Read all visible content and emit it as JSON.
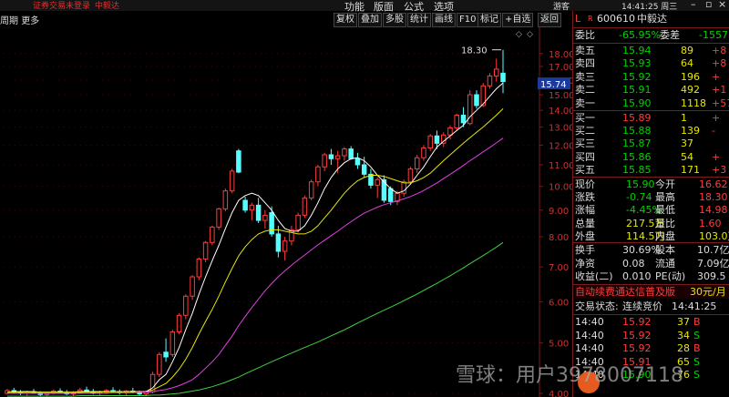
{
  "topbar": {
    "status_text": "证券交易未登录",
    "stock_name": "中毅达",
    "menus": [
      "功能",
      "版面",
      "公式",
      "选项"
    ],
    "extra_menu": "游客",
    "clock": "14:41:25 周三"
  },
  "toolbar": {
    "period": "周期",
    "more": "更多",
    "buttons": [
      "复权",
      "叠加",
      "多股",
      "统计",
      "画线",
      "F10",
      "标记",
      "+自选",
      "返回"
    ]
  },
  "chart_data": {
    "type": "candlestick",
    "title": "",
    "y_ticks": [
      4.0,
      5.0,
      6.0,
      7.0,
      8.0,
      9.0,
      10.0,
      11.0,
      12.0,
      13.0,
      14.0,
      15.0,
      16.0,
      17.0,
      18.0
    ],
    "ylim": [
      4.0,
      18.5
    ],
    "current_price_label": "15.74",
    "high_annotation": "18.30",
    "candles": [
      [
        4.0,
        4.08,
        3.98,
        4.05
      ],
      [
        4.05,
        4.1,
        4.0,
        4.02
      ],
      [
        4.02,
        4.06,
        3.97,
        4.0
      ],
      [
        4.0,
        4.05,
        3.96,
        4.03
      ],
      [
        4.03,
        4.08,
        3.99,
        4.01
      ],
      [
        4.01,
        4.04,
        3.95,
        3.98
      ],
      [
        3.98,
        4.03,
        3.94,
        4.0
      ],
      [
        4.0,
        4.07,
        3.98,
        4.04
      ],
      [
        4.04,
        4.09,
        4.0,
        4.02
      ],
      [
        4.02,
        4.06,
        3.97,
        3.99
      ],
      [
        3.99,
        4.04,
        3.95,
        4.01
      ],
      [
        4.01,
        4.1,
        3.99,
        4.06
      ],
      [
        4.06,
        4.12,
        4.02,
        4.03
      ],
      [
        4.03,
        4.08,
        3.98,
        4.0
      ],
      [
        4.0,
        4.05,
        3.96,
        4.02
      ],
      [
        4.02,
        4.08,
        3.99,
        4.05
      ],
      [
        4.05,
        4.11,
        4.01,
        4.03
      ],
      [
        4.03,
        4.07,
        3.98,
        4.01
      ],
      [
        4.01,
        4.06,
        3.97,
        4.04
      ],
      [
        4.04,
        4.1,
        4.0,
        4.02
      ],
      [
        4.02,
        4.05,
        3.96,
        3.99
      ],
      [
        3.99,
        4.05,
        3.95,
        4.03
      ],
      [
        4.03,
        4.4,
        4.0,
        4.35
      ],
      [
        4.35,
        4.8,
        4.3,
        4.75
      ],
      [
        4.8,
        5.1,
        4.6,
        4.7
      ],
      [
        4.75,
        5.3,
        4.7,
        5.25
      ],
      [
        5.25,
        5.7,
        5.2,
        5.65
      ],
      [
        5.65,
        6.2,
        5.55,
        6.15
      ],
      [
        6.15,
        6.75,
        6.05,
        6.7
      ],
      [
        6.7,
        7.3,
        6.6,
        7.25
      ],
      [
        7.25,
        7.85,
        7.15,
        7.8
      ],
      [
        7.8,
        8.4,
        7.7,
        8.35
      ],
      [
        8.35,
        9.1,
        8.25,
        9.05
      ],
      [
        9.05,
        9.9,
        8.95,
        9.8
      ],
      [
        9.8,
        10.8,
        9.7,
        10.7
      ],
      [
        11.7,
        11.8,
        10.6,
        10.65
      ],
      [
        9.4,
        9.55,
        8.9,
        9.0
      ],
      [
        9.0,
        9.3,
        8.6,
        9.2
      ],
      [
        9.2,
        9.5,
        8.5,
        8.6
      ],
      [
        8.6,
        9.0,
        8.3,
        8.8
      ],
      [
        8.9,
        9.15,
        8.0,
        8.1
      ],
      [
        8.1,
        8.4,
        7.3,
        7.5
      ],
      [
        7.5,
        8.0,
        7.2,
        7.85
      ],
      [
        7.85,
        8.4,
        7.7,
        8.25
      ],
      [
        8.25,
        8.9,
        8.15,
        8.8
      ],
      [
        8.8,
        9.6,
        8.7,
        9.5
      ],
      [
        9.5,
        10.3,
        9.4,
        10.2
      ],
      [
        10.2,
        11.0,
        10.0,
        10.9
      ],
      [
        10.9,
        11.6,
        10.7,
        11.5
      ],
      [
        11.5,
        11.8,
        11.0,
        11.3
      ],
      [
        11.3,
        11.7,
        10.6,
        11.45
      ],
      [
        11.45,
        11.9,
        11.2,
        11.8
      ],
      [
        11.8,
        11.95,
        11.25,
        11.3
      ],
      [
        11.3,
        11.6,
        10.8,
        11.0
      ],
      [
        11.0,
        11.4,
        10.4,
        10.55
      ],
      [
        10.55,
        10.8,
        9.9,
        10.05
      ],
      [
        10.05,
        10.4,
        9.5,
        10.3
      ],
      [
        10.3,
        10.5,
        9.3,
        9.4
      ],
      [
        9.9,
        10.0,
        9.2,
        9.35
      ],
      [
        9.35,
        9.8,
        9.2,
        9.7
      ],
      [
        9.7,
        10.3,
        9.55,
        10.2
      ],
      [
        10.2,
        10.9,
        10.1,
        10.8
      ],
      [
        10.8,
        11.5,
        10.6,
        11.35
      ],
      [
        11.35,
        12.0,
        11.2,
        11.85
      ],
      [
        11.85,
        12.6,
        11.7,
        12.5
      ],
      [
        12.5,
        12.8,
        11.8,
        12.1
      ],
      [
        12.1,
        12.7,
        11.9,
        12.55
      ],
      [
        12.55,
        13.1,
        12.3,
        12.95
      ],
      [
        12.95,
        13.8,
        12.8,
        13.7
      ],
      [
        13.7,
        14.2,
        13.0,
        13.25
      ],
      [
        13.2,
        15.3,
        13.1,
        15.0
      ],
      [
        15.0,
        15.3,
        14.1,
        14.3
      ],
      [
        14.3,
        15.8,
        14.2,
        15.6
      ],
      [
        15.6,
        16.5,
        15.4,
        16.3
      ],
      [
        16.3,
        17.6,
        15.9,
        16.8
      ],
      [
        16.5,
        18.3,
        15.1,
        15.9
      ]
    ],
    "ma": [
      {
        "name": "MA5",
        "color": "#ffffff",
        "values": [
          4.02,
          4.03,
          4.03,
          4.03,
          4.03,
          4.02,
          4.02,
          4.02,
          4.02,
          4.02,
          4.02,
          4.03,
          4.03,
          4.03,
          4.03,
          4.03,
          4.03,
          4.03,
          4.03,
          4.03,
          4.03,
          4.03,
          4.1,
          4.25,
          4.35,
          4.6,
          4.9,
          5.3,
          5.7,
          6.2,
          6.7,
          7.2,
          7.7,
          8.3,
          8.9,
          9.4,
          9.6,
          9.7,
          9.6,
          9.3,
          9.0,
          8.6,
          8.3,
          8.2,
          8.2,
          8.4,
          8.8,
          9.3,
          9.9,
          10.4,
          10.8,
          11.1,
          11.3,
          11.35,
          11.2,
          10.9,
          10.5,
          10.2,
          9.9,
          9.7,
          9.8,
          10.1,
          10.5,
          10.9,
          11.4,
          11.9,
          12.2,
          12.5,
          12.8,
          13.1,
          13.6,
          14.0,
          14.4,
          14.9,
          15.4,
          15.8
        ]
      },
      {
        "name": "MA10",
        "color": "#e6e600",
        "values": [
          4.02,
          4.02,
          4.02,
          4.02,
          4.02,
          4.02,
          4.02,
          4.02,
          4.02,
          4.02,
          4.02,
          4.02,
          4.02,
          4.02,
          4.02,
          4.03,
          4.03,
          4.03,
          4.03,
          4.03,
          4.03,
          4.03,
          4.06,
          4.12,
          4.18,
          4.3,
          4.45,
          4.65,
          4.9,
          5.2,
          5.5,
          5.8,
          6.15,
          6.55,
          6.95,
          7.35,
          7.65,
          7.9,
          8.1,
          8.2,
          8.25,
          8.25,
          8.2,
          8.15,
          8.1,
          8.1,
          8.2,
          8.4,
          8.7,
          9.0,
          9.35,
          9.7,
          10.0,
          10.25,
          10.4,
          10.5,
          10.5,
          10.45,
          10.35,
          10.25,
          10.15,
          10.15,
          10.25,
          10.4,
          10.6,
          10.9,
          11.2,
          11.5,
          11.8,
          12.1,
          12.4,
          12.7,
          13.0,
          13.35,
          13.7,
          14.1
        ]
      },
      {
        "name": "MA20",
        "color": "#e040e0",
        "values": [
          4.0,
          4.0,
          4.0,
          4.0,
          4.0,
          4.0,
          4.0,
          4.0,
          4.0,
          4.0,
          4.0,
          4.0,
          4.0,
          4.0,
          4.0,
          4.0,
          4.01,
          4.01,
          4.01,
          4.01,
          4.02,
          4.02,
          4.03,
          4.05,
          4.07,
          4.1,
          4.14,
          4.19,
          4.25,
          4.35,
          4.47,
          4.6,
          4.75,
          4.95,
          5.15,
          5.4,
          5.62,
          5.85,
          6.07,
          6.3,
          6.5,
          6.7,
          6.88,
          7.05,
          7.22,
          7.38,
          7.55,
          7.72,
          7.88,
          8.04,
          8.2,
          8.38,
          8.55,
          8.72,
          8.88,
          9.0,
          9.12,
          9.22,
          9.3,
          9.38,
          9.46,
          9.56,
          9.68,
          9.82,
          9.98,
          10.15,
          10.35,
          10.55,
          10.75,
          10.97,
          11.2,
          11.42,
          11.65,
          11.88,
          12.12,
          12.38
        ]
      },
      {
        "name": "MA60",
        "color": "#40d040",
        "values": [
          3.95,
          3.95,
          3.95,
          3.95,
          3.95,
          3.95,
          3.95,
          3.95,
          3.95,
          3.95,
          3.95,
          3.96,
          3.96,
          3.96,
          3.96,
          3.96,
          3.96,
          3.96,
          3.96,
          3.96,
          3.96,
          3.96,
          3.97,
          3.97,
          3.98,
          3.99,
          4.0,
          4.02,
          4.04,
          4.06,
          4.09,
          4.12,
          4.16,
          4.2,
          4.25,
          4.3,
          4.36,
          4.42,
          4.48,
          4.54,
          4.6,
          4.66,
          4.72,
          4.78,
          4.84,
          4.9,
          4.96,
          5.02,
          5.09,
          5.16,
          5.23,
          5.3,
          5.38,
          5.46,
          5.54,
          5.62,
          5.7,
          5.78,
          5.86,
          5.94,
          6.03,
          6.12,
          6.21,
          6.31,
          6.41,
          6.51,
          6.62,
          6.73,
          6.85,
          6.97,
          7.1,
          7.23,
          7.36,
          7.5,
          7.64,
          7.8
        ]
      }
    ]
  },
  "quote": {
    "code": "600610",
    "name": "中毅达",
    "weibi_label": "委比",
    "weibi": "-65.95%",
    "weicha_label": "委差",
    "weicha": "-1557",
    "asks": [
      {
        "label": "卖五",
        "price": "15.94",
        "vol": "89",
        "chg": "+8"
      },
      {
        "label": "卖四",
        "price": "15.93",
        "vol": "64",
        "chg": "+8"
      },
      {
        "label": "卖三",
        "price": "15.92",
        "vol": "196",
        "chg": "+"
      },
      {
        "label": "卖二",
        "price": "15.91",
        "vol": "492",
        "chg": "+1"
      },
      {
        "label": "卖一",
        "price": "15.90",
        "vol": "1118",
        "chg": "+57"
      }
    ],
    "bids": [
      {
        "label": "买一",
        "price": "15.89",
        "vol": "1",
        "chg": "+"
      },
      {
        "label": "买二",
        "price": "15.88",
        "vol": "139",
        "chg": "-"
      },
      {
        "label": "买三",
        "price": "15.87",
        "vol": "37",
        "chg": ""
      },
      {
        "label": "买四",
        "price": "15.86",
        "vol": "54",
        "chg": "+"
      },
      {
        "label": "买五",
        "price": "15.85",
        "vol": "171",
        "chg": "+3"
      }
    ],
    "stats": [
      {
        "l1": "现价",
        "v1": "15.90",
        "l2": "今开",
        "v2": "16.62"
      },
      {
        "l1": "涨跌",
        "v1": "-0.74",
        "l2": "最高",
        "v2": "18.30"
      },
      {
        "l1": "涨幅",
        "v1": "-4.45%",
        "l2": "最低",
        "v2": "14.98"
      },
      {
        "l1": "总量",
        "v1": "217.5万",
        "l2": "量比",
        "v2": "1.60"
      },
      {
        "l1": "外盘",
        "v1": "114.5万",
        "l2": "内盘",
        "v2": "103.0万"
      }
    ],
    "fund": [
      {
        "l1": "换手",
        "v1": "30.69%",
        "l2": "股本",
        "v2": "10.7亿"
      },
      {
        "l1": "净资",
        "v1": "0.08",
        "l2": "流通",
        "v2": "7.09亿"
      },
      {
        "l1": "收益(二)",
        "v1": "0.010",
        "l2": "PE(动)",
        "v2": "309.5"
      }
    ],
    "promo": "自动续费通达信普及版",
    "promo_price": "30元/月",
    "trade_status_label": "交易状态:",
    "trade_status": "连续竞价",
    "trade_time": "14:41:25",
    "ticks": [
      {
        "time": "14:40",
        "price": "15.92",
        "vol": "37",
        "side": "B"
      },
      {
        "time": "14:40",
        "price": "15.92",
        "vol": "34",
        "side": "S"
      },
      {
        "time": "14:40",
        "price": "15.92",
        "vol": "28",
        "side": "B"
      },
      {
        "time": "14:40",
        "price": "15.91",
        "vol": "65",
        "side": "S"
      },
      {
        "time": "14:40",
        "price": "15.90",
        "vol": "76",
        "side": "S"
      }
    ]
  },
  "watermark": "雪球：用户3978007118"
}
